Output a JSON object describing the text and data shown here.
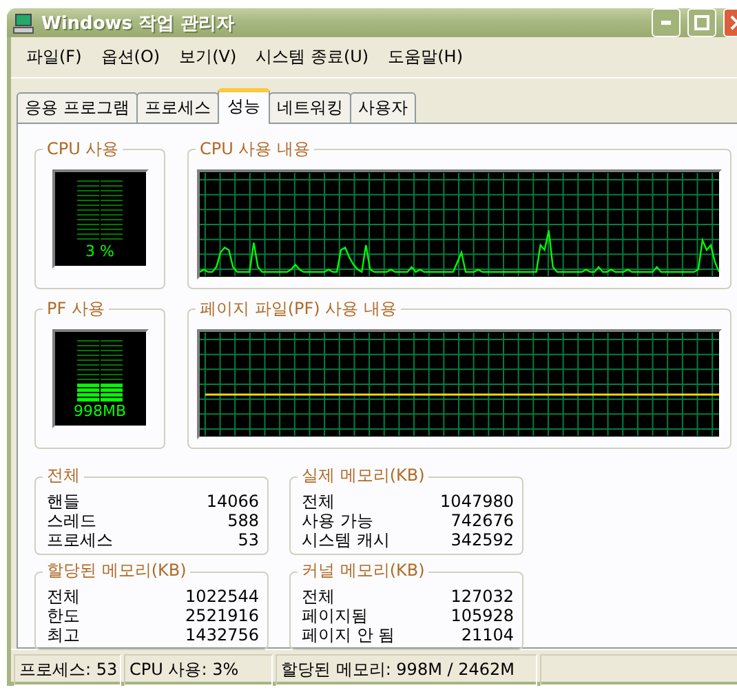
{
  "window": {
    "title": "Windows 작업 관리자"
  },
  "menu": [
    {
      "label": "파일(F)"
    },
    {
      "label": "옵션(O)"
    },
    {
      "label": "보기(V)"
    },
    {
      "label": "시스템 종료(U)"
    },
    {
      "label": "도움말(H)"
    }
  ],
  "tabs": [
    {
      "label": "응용 프로그램",
      "selected": false
    },
    {
      "label": "프로세스",
      "selected": false
    },
    {
      "label": "성능",
      "selected": true
    },
    {
      "label": "네트워킹",
      "selected": false
    },
    {
      "label": "사용자",
      "selected": false
    }
  ],
  "gauges": [
    {
      "title": "CPU 사용",
      "reading": "3 %",
      "level": 0.03
    },
    {
      "title": "PF 사용",
      "reading": "998MB",
      "level": 0.4
    }
  ],
  "history": [
    {
      "title": "CPU 사용 내용",
      "kind": "cpu"
    },
    {
      "title": "페이지 파일(PF) 사용 내용",
      "kind": "pagefile"
    }
  ],
  "stat_groups": [
    {
      "title": "전체",
      "rows": [
        {
          "label": "핸들",
          "value": "14066"
        },
        {
          "label": "스레드",
          "value": "588"
        },
        {
          "label": "프로세스",
          "value": "53"
        }
      ]
    },
    {
      "title": "실제 메모리(KB)",
      "rows": [
        {
          "label": "전체",
          "value": "1047980"
        },
        {
          "label": "사용 가능",
          "value": "742676"
        },
        {
          "label": "시스템 캐시",
          "value": "342592"
        }
      ]
    },
    {
      "title": "할당된 메모리(KB)",
      "rows": [
        {
          "label": "전체",
          "value": "1022544"
        },
        {
          "label": "한도",
          "value": "2521916"
        },
        {
          "label": "최고",
          "value": "1432756"
        }
      ]
    },
    {
      "title": "커널 메모리(KB)",
      "rows": [
        {
          "label": "전체",
          "value": "127032"
        },
        {
          "label": "페이지됨",
          "value": "105928"
        },
        {
          "label": "페이지 안 됨",
          "value": "21104"
        }
      ]
    }
  ],
  "status_bar": [
    "프로세스: 53",
    "CPU 사용: 3%",
    "할당된 메모리: 998M / 2462M"
  ]
}
